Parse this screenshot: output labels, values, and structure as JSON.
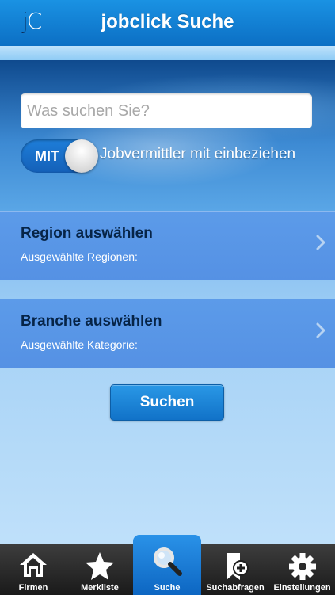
{
  "header": {
    "logo_j": "j",
    "logo_c": "C",
    "title": "jobclick Suche"
  },
  "search": {
    "placeholder": "Was suchen Sie?",
    "value": ""
  },
  "toggle": {
    "label": "MIT",
    "text": "Jobvermittler mit einbeziehen",
    "state": "on"
  },
  "region": {
    "title": "Region auswählen",
    "subtitle": "Ausgewählte Regionen:"
  },
  "branche": {
    "title": "Branche auswählen",
    "subtitle": "Ausgewählte Kategorie:"
  },
  "submit": {
    "label": "Suchen"
  },
  "tabs": [
    {
      "label": "Firmen",
      "icon": "house-icon"
    },
    {
      "label": "Merkliste",
      "icon": "star-icon"
    },
    {
      "label": "Suche",
      "icon": "magnifier-icon",
      "active": true
    },
    {
      "label": "Suchabfragen",
      "icon": "saved-search-icon"
    },
    {
      "label": "Einstellungen",
      "icon": "gear-icon"
    }
  ],
  "colors": {
    "accent": "#1a86dc",
    "header": "#1a92e3",
    "tabbar": "#1a1a1a"
  }
}
